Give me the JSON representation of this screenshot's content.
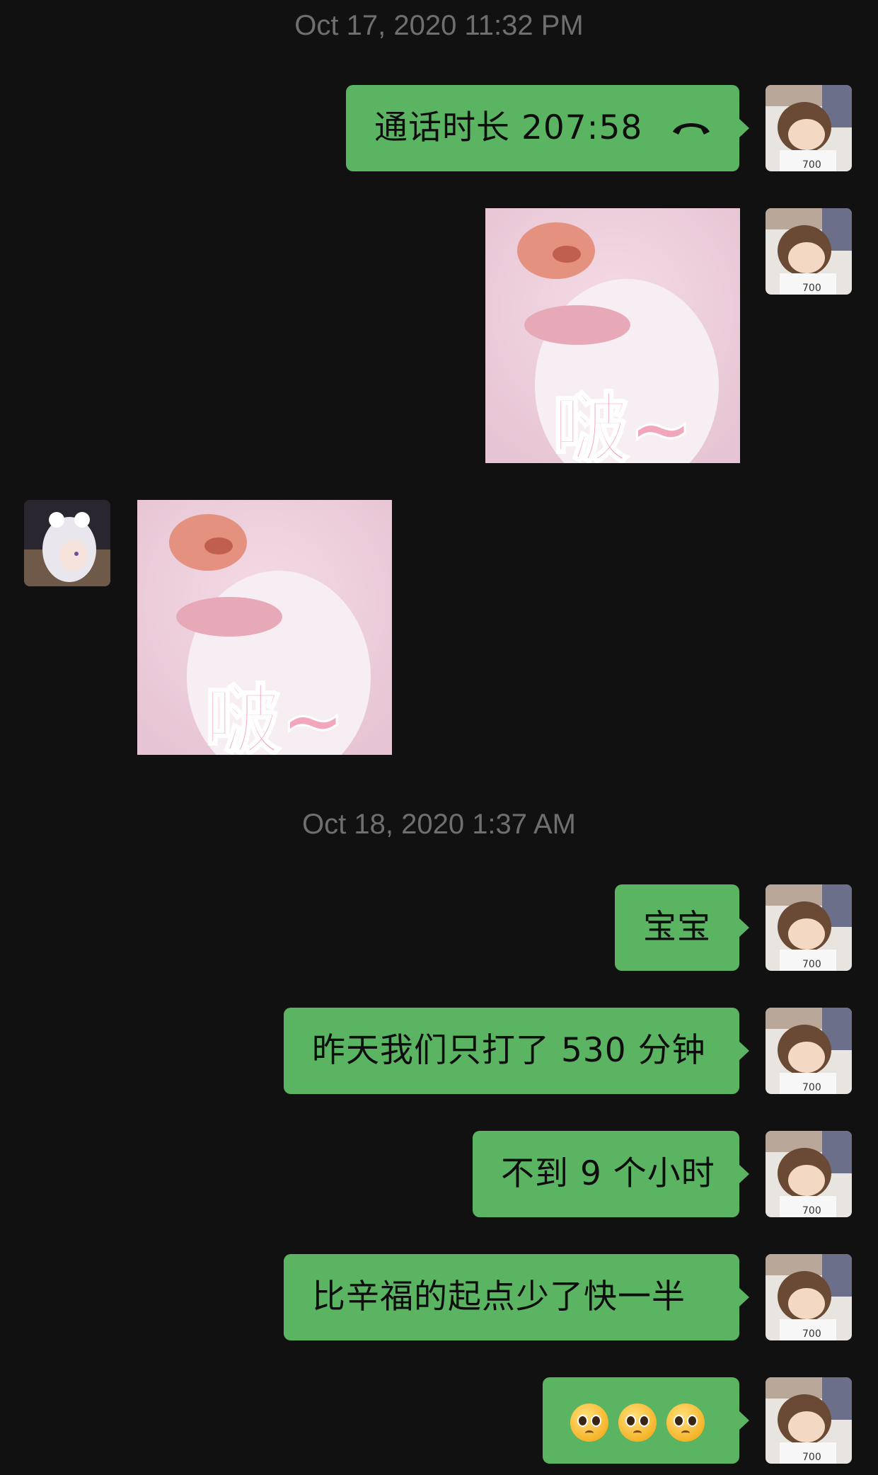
{
  "chat": {
    "timestamp_1": "Oct 17, 2020 11:32 PM",
    "timestamp_2": "Oct 18, 2020 1:37 AM",
    "call_message": "通话时长 207:58",
    "sticker_text": "啵~",
    "messages": [
      "宝宝",
      "昨天我们只打了 530 分钟",
      "不到 9 个小时",
      "比辛福的起点少了快一半"
    ],
    "emoji_message": "pleading-face x3",
    "colors": {
      "background": "#111111",
      "bubble_green": "#5bb461",
      "timestamp_gray": "#6f6f6f"
    },
    "icons": {
      "call": "phone-hangup-icon",
      "emoji": "pleading-face-icon"
    }
  }
}
